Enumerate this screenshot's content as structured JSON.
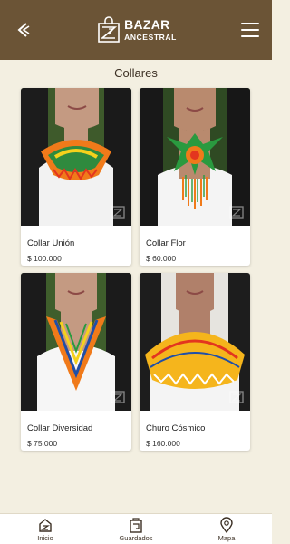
{
  "header": {
    "logo_title": "BAZAR",
    "logo_subtitle": "ANCESTRAL",
    "back_icon": "back-chevron-icon",
    "menu_icon": "hamburger-menu-icon"
  },
  "section": {
    "title": "Collares"
  },
  "products": [
    {
      "name": "Collar Unión",
      "price": "$ 100.000",
      "image": "beaded-collar-orange-green"
    },
    {
      "name": "Collar Flor",
      "price": "$ 60.000",
      "image": "beaded-flower-necklace"
    },
    {
      "name": "Collar Diversidad",
      "price": "$ 75.000",
      "image": "beaded-triangle-necklace"
    },
    {
      "name": "Churo Cósmico",
      "price": "$ 160.000",
      "image": "beaded-yellow-collar"
    }
  ],
  "nav": {
    "items": [
      {
        "label": "Inicio",
        "icon": "home-icon"
      },
      {
        "label": "Guardados",
        "icon": "saved-icon"
      },
      {
        "label": "Mapa",
        "icon": "map-pin-icon"
      }
    ]
  },
  "colors": {
    "header_bg": "#6b5436",
    "page_bg": "#f3efe1",
    "text": "#3b2f23"
  }
}
